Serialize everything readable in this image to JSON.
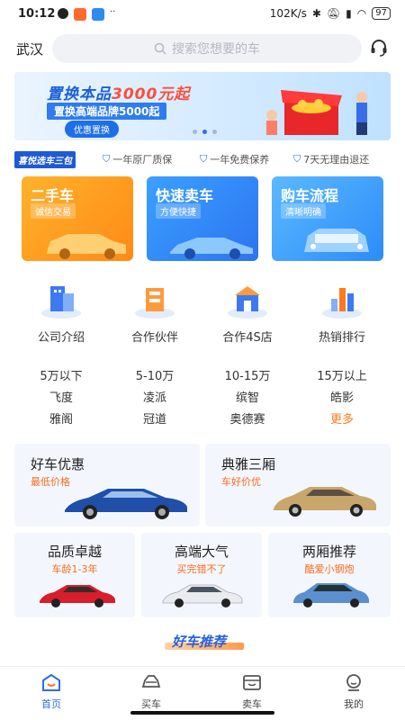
{
  "status_bar": {
    "time": "10:12",
    "net_speed": "102K/s",
    "battery": "97"
  },
  "header": {
    "city": "武汉",
    "search_placeholder": "搜索您想要的车"
  },
  "banner": {
    "title_prefix": "置换本品",
    "title_highlight": "3000元起",
    "subtitle": "置换高端品牌5000起",
    "button": "优惠置换",
    "page_count": 3,
    "active_page": 2
  },
  "guarantees": {
    "badge": "喜悦选车三包",
    "items": [
      "一年原厂质保",
      "一年免费保养",
      "7天无理由退还"
    ]
  },
  "tiles": [
    {
      "title": "二手车",
      "subtitle": "诚信交易"
    },
    {
      "title": "快速卖车",
      "subtitle": "方便快捷"
    },
    {
      "title": "购车流程",
      "subtitle": "清晰明确"
    }
  ],
  "categories": [
    "公司介绍",
    "合作伙伴",
    "合作4S店",
    "热销排行"
  ],
  "quick_filters": [
    [
      "5万以下",
      "5-10万",
      "10-15万",
      "15万以上"
    ],
    [
      "飞度",
      "凌派",
      "缤智",
      "皓影"
    ],
    [
      "雅阁",
      "冠道",
      "奥德赛",
      "更多"
    ]
  ],
  "promo_large": [
    {
      "title": "好车优惠",
      "subtitle": "最低价格"
    },
    {
      "title": "典雅三厢",
      "subtitle": "车好价优"
    }
  ],
  "promo_small": [
    {
      "title": "品质卓越",
      "subtitle": "车龄1-3年"
    },
    {
      "title": "高端大气",
      "subtitle": "买完错不了"
    },
    {
      "title": "两厢推荐",
      "subtitle": "酷爱小钢炮"
    }
  ],
  "section_title": "好车推荐",
  "nav": [
    {
      "label": "首页",
      "icon": "home-icon",
      "active": true
    },
    {
      "label": "买车",
      "icon": "car-icon",
      "active": false
    },
    {
      "label": "卖车",
      "icon": "sell-icon",
      "active": false
    },
    {
      "label": "我的",
      "icon": "profile-icon",
      "active": false
    }
  ],
  "colors": {
    "accent": "#2a6fe8",
    "highlight": "#ff7a1a"
  }
}
